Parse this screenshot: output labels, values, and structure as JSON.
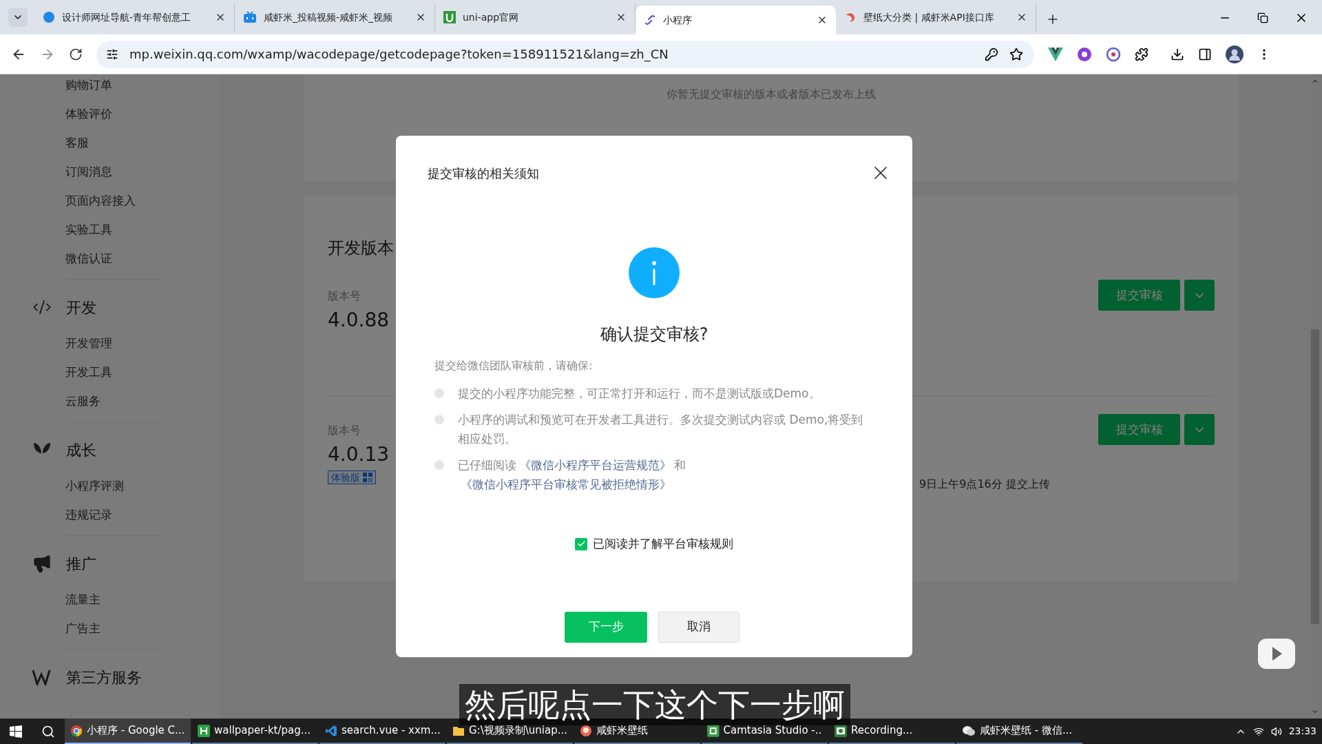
{
  "browser": {
    "tabs": [
      {
        "title": "设计师网址导航-青年帮创意工",
        "selected": false
      },
      {
        "title": "咸虾米_投稿视频-咸虾米_视频",
        "selected": false
      },
      {
        "title": "uni-app官网",
        "selected": false
      },
      {
        "title": "小程序",
        "selected": true
      },
      {
        "title": "壁纸大分类 | 咸虾米API接口库",
        "selected": false
      }
    ],
    "url": "mp.weixin.qq.com/wxamp/wacodepage/getcodepage?token=158911521&lang=zh_CN"
  },
  "sidebar": {
    "top_items": [
      "购物订单",
      "体验评价",
      "客服",
      "订阅消息",
      "页面内容接入",
      "实验工具",
      "微信认证"
    ],
    "sections": [
      {
        "label": "开发",
        "items": [
          "开发管理",
          "开发工具",
          "云服务"
        ]
      },
      {
        "label": "成长",
        "items": [
          "小程序评测",
          "违规记录"
        ]
      },
      {
        "label": "推广",
        "items": [
          "流量主",
          "广告主"
        ]
      },
      {
        "label": "第三方服务"
      }
    ]
  },
  "page": {
    "notice": "你暂无提交审核的版本或者版本已发布上线",
    "dev_section": {
      "title": "开发版本",
      "versions": [
        {
          "label": "版本号",
          "number": "4.0.88",
          "submit": "提交审核"
        },
        {
          "label": "版本号",
          "number": "4.0.13",
          "tag": "体验版",
          "info": "9日上午9点16分 提交上传",
          "submit": "提交审核"
        }
      ]
    }
  },
  "dialog": {
    "title": "提交审核的相关须知",
    "heading": "确认提交审核?",
    "intro": "提交给微信团队审核前，请确保:",
    "bullets": [
      {
        "parts": [
          {
            "kind": "text",
            "text": "提交的小程序功能完整，可正常打开和运行，而不是测试版或Demo。"
          }
        ]
      },
      {
        "parts": [
          {
            "kind": "text",
            "text": "小程序的调试和预览可在开发者工具进行。多次提交测试内容或 Demo,将受到相应处罚。"
          }
        ]
      },
      {
        "parts": [
          {
            "kind": "text",
            "text": "已仔细阅读"
          },
          {
            "kind": "link",
            "text": "《微信小程序平台运营规范》"
          },
          {
            "kind": "text",
            "text": "和"
          },
          {
            "kind": "link",
            "text": "《微信小程序平台审核常见被拒绝情形》"
          }
        ]
      }
    ],
    "agree": {
      "label": "已阅读并了解平台审核规则",
      "checked": true
    },
    "buttons": [
      {
        "label": "下一步",
        "kind": "primary"
      },
      {
        "label": "取消",
        "kind": "secondary"
      }
    ]
  },
  "subtitle": "然后呢点一下这个下一步啊",
  "taskbar": {
    "items": [
      {
        "label": "小程序 - Google C...",
        "selected": true
      },
      {
        "label": "wallpaper-kt/pag...",
        "selected": false
      },
      {
        "label": "search.vue - xxm...",
        "selected": false
      },
      {
        "label": "G:\\视频录制\\uniap...",
        "selected": false
      },
      {
        "label": "咸虾米壁纸",
        "selected": false
      },
      {
        "label": "Camtasia Studio -...",
        "selected": false
      },
      {
        "label": "Recording...",
        "selected": false
      },
      {
        "label": "咸虾米壁纸 - 微信...",
        "selected": false
      }
    ],
    "time": "23:33"
  }
}
